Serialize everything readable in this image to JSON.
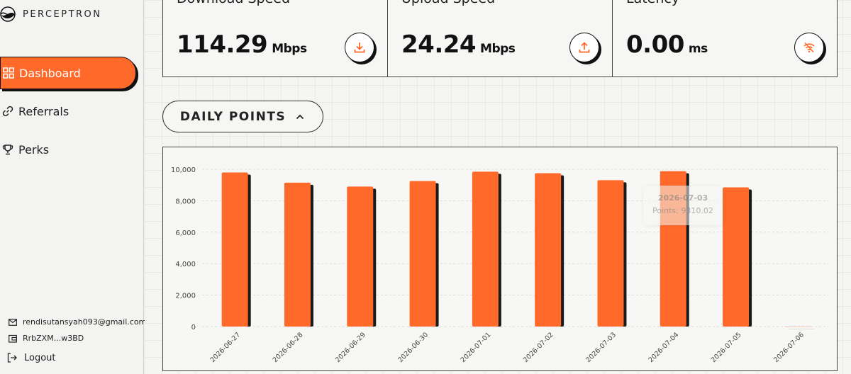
{
  "brand": {
    "name": "PERCEPTRON"
  },
  "nav": {
    "items": [
      {
        "label": "Dashboard",
        "active": true,
        "icon": "grid-icon"
      },
      {
        "label": "Referrals",
        "active": false,
        "icon": "link-icon"
      },
      {
        "label": "Perks",
        "active": false,
        "icon": "trophy-icon"
      }
    ]
  },
  "account": {
    "email": "rendisutansyah093@gmail.com",
    "wallet": "RrbZXM...w3BD",
    "logout_label": "Logout"
  },
  "stats": [
    {
      "label": "Download Speed",
      "value": "114.29",
      "unit": "Mbps",
      "icon": "download-icon"
    },
    {
      "label": "Upload Speed",
      "value": "24.24",
      "unit": "Mbps",
      "icon": "upload-icon"
    },
    {
      "label": "Latency",
      "value": "0.00",
      "unit": "ms",
      "icon": "wifi-off-icon"
    }
  ],
  "daily_points": {
    "label": "DAILY POINTS"
  },
  "colors": {
    "accent": "#ff6a2b",
    "shadow": "#111111"
  },
  "tooltip": {
    "date": "2026-07-03",
    "text": "Points: 9310.02"
  },
  "chart_data": {
    "type": "bar",
    "categories": [
      "2026-06-27",
      "2026-06-28",
      "2026-06-29",
      "2026-06-30",
      "2026-07-01",
      "2026-07-02",
      "2026-07-03",
      "2026-07-04",
      "2026-07-05",
      "2026-07-06"
    ],
    "values": [
      9800,
      9150,
      8900,
      9250,
      9850,
      9750,
      9310.02,
      9880,
      8850,
      0
    ],
    "yticks": [
      "10,000",
      "8,000",
      "6,000",
      "4,000",
      "2,000",
      "0"
    ],
    "ylim": [
      0,
      10000
    ],
    "grid": true,
    "xlabel": "",
    "ylabel": ""
  }
}
